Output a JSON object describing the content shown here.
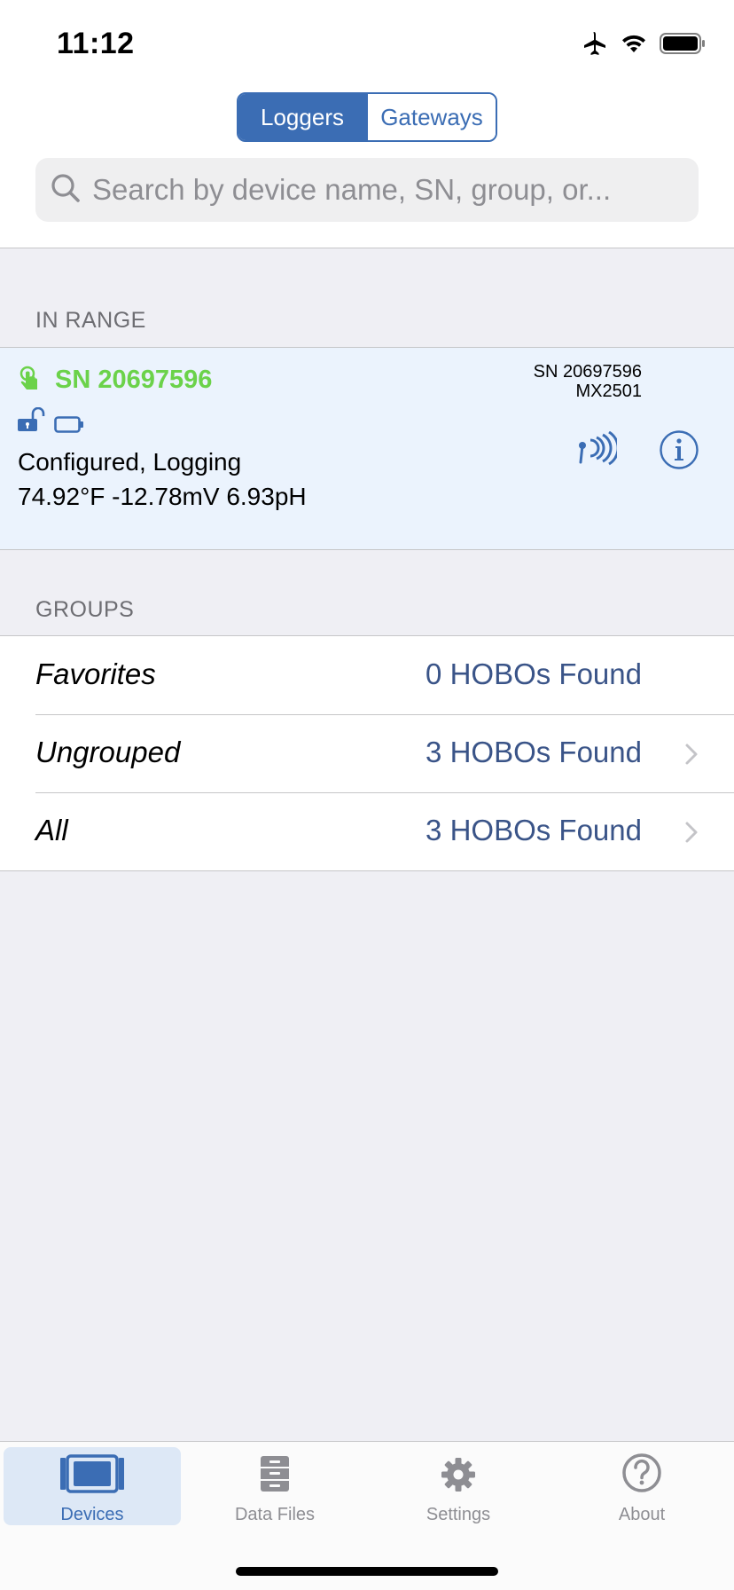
{
  "status_bar": {
    "time": "11:12",
    "icons": [
      "airplane-icon",
      "wifi-icon",
      "battery-icon"
    ]
  },
  "segmented": {
    "loggers": "Loggers",
    "gateways": "Gateways",
    "selected": "Loggers"
  },
  "search": {
    "placeholder": "Search by device name, SN, group, or..."
  },
  "in_range": {
    "label": "IN RANGE",
    "device": {
      "name": "SN 20697596",
      "sn": "SN 20697596",
      "model": "MX2501",
      "status": "Configured, Logging",
      "readings": "74.92°F -12.78mV 6.93pH"
    }
  },
  "groups": {
    "label": "GROUPS",
    "rows": [
      {
        "name": "Favorites",
        "count": "0 HOBOs Found"
      },
      {
        "name": "Ungrouped",
        "count": "3 HOBOs Found"
      },
      {
        "name": "All",
        "count": "3 HOBOs Found"
      }
    ]
  },
  "tabbar": {
    "devices": "Devices",
    "data_files": "Data Files",
    "settings": "Settings",
    "about": "About"
  },
  "colors": {
    "accent": "#3b6db4",
    "device_name": "#6bd24a",
    "row_highlight": "#ebf3fd",
    "count_text": "#3a5488"
  }
}
